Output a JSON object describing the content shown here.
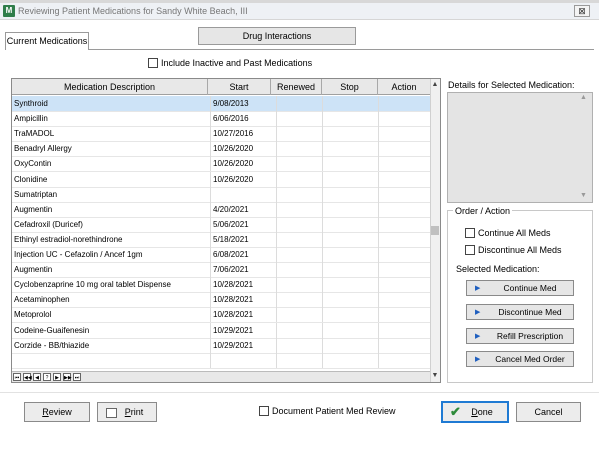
{
  "window": {
    "title": "Reviewing Patient Medications for Sandy White Beach, III",
    "close_glyph": "⊠",
    "app_icon_text": "M"
  },
  "tabs": [
    {
      "label": "Current Medications",
      "active": true
    },
    {
      "label": "Drug Interactions",
      "active": false
    }
  ],
  "include_inactive": {
    "label": "Include Inactive and Past Medications",
    "checked": false
  },
  "table": {
    "columns": [
      "Medication Description",
      "Start",
      "Renewed",
      "Stop",
      "Action"
    ],
    "rows": [
      {
        "desc": "Synthroid",
        "start": "9/08/2013",
        "renewed": "",
        "stop": "",
        "action": "",
        "selected": true
      },
      {
        "desc": "Ampicillin",
        "start": "6/06/2016",
        "renewed": "",
        "stop": "",
        "action": ""
      },
      {
        "desc": "TraMADOL",
        "start": "10/27/2016",
        "renewed": "",
        "stop": "",
        "action": ""
      },
      {
        "desc": "Benadryl Allergy",
        "start": "10/26/2020",
        "renewed": "",
        "stop": "",
        "action": ""
      },
      {
        "desc": "OxyContin",
        "start": "10/26/2020",
        "renewed": "",
        "stop": "",
        "action": ""
      },
      {
        "desc": "Clonidine",
        "start": "10/26/2020",
        "renewed": "",
        "stop": "",
        "action": ""
      },
      {
        "desc": "Sumatriptan",
        "start": "",
        "renewed": "",
        "stop": "",
        "action": ""
      },
      {
        "desc": "Augmentin",
        "start": "4/20/2021",
        "renewed": "",
        "stop": "",
        "action": ""
      },
      {
        "desc": "Cefadroxil (Duricef)",
        "start": "5/06/2021",
        "renewed": "",
        "stop": "",
        "action": ""
      },
      {
        "desc": "Ethinyl estradiol-norethindrone",
        "start": "5/18/2021",
        "renewed": "",
        "stop": "",
        "action": ""
      },
      {
        "desc": "Injection UC - Cefazolin / Ancef 1gm",
        "start": "6/08/2021",
        "renewed": "",
        "stop": "",
        "action": ""
      },
      {
        "desc": "Augmentin",
        "start": "7/06/2021",
        "renewed": "",
        "stop": "",
        "action": ""
      },
      {
        "desc": "Cyclobenzaprine 10 mg oral tablet Dispense",
        "start": "10/28/2021",
        "renewed": "",
        "stop": "",
        "action": ""
      },
      {
        "desc": "Acetaminophen",
        "start": "10/28/2021",
        "renewed": "",
        "stop": "",
        "action": ""
      },
      {
        "desc": "Metoprolol",
        "start": "10/28/2021",
        "renewed": "",
        "stop": "",
        "action": ""
      },
      {
        "desc": "Codeine-Guaifenesin",
        "start": "10/29/2021",
        "renewed": "",
        "stop": "",
        "action": ""
      },
      {
        "desc": "Corzide - BB/thiazide",
        "start": "10/29/2021",
        "renewed": "",
        "stop": "",
        "action": ""
      },
      {
        "desc": "",
        "start": "",
        "renewed": "",
        "stop": "",
        "action": ""
      }
    ],
    "scroll_up": "▲",
    "scroll_down": "▼",
    "pager": [
      "⏮",
      "◀◀",
      "◀",
      "?",
      "▶",
      "▶▶",
      "⏭"
    ]
  },
  "details": {
    "label": "Details for Selected Medication:",
    "scroll_up": "▲",
    "scroll_down": "▼"
  },
  "order_action": {
    "label": "Order / Action",
    "continue_all": "Continue All Meds",
    "discontinue_all": "Discontinue All Meds",
    "selected_label": "Selected Medication:",
    "button_glyph": "▶",
    "continue_med": "Continue Med",
    "discontinue_med": "Discontinue Med",
    "refill": "Refill Prescription",
    "cancel_order": "Cancel Med Order"
  },
  "footer": {
    "review_first": "R",
    "review_rest": "eview",
    "print_first": "P",
    "print_rest": "rint",
    "document_review": "Document Patient Med Review",
    "done_check": "✔",
    "done_first": "D",
    "done_rest": "one",
    "cancel": "Cancel"
  },
  "colors": {
    "selected_row": "#cde3f7",
    "done_border": "#1f7ad3",
    "done_check": "#2e8b3a",
    "button_glyph": "#1f5fbf"
  }
}
